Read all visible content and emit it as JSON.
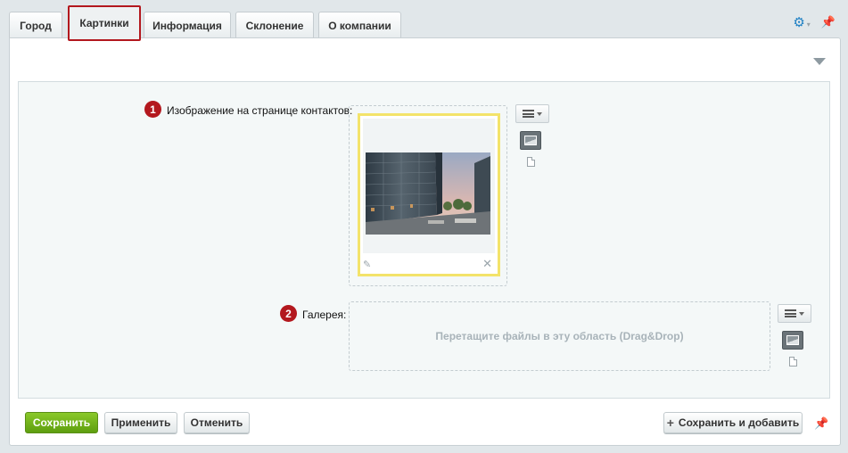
{
  "tabs": [
    {
      "label": "Город",
      "active": false
    },
    {
      "label": "Картинки",
      "active": true
    },
    {
      "label": "Информация",
      "active": false
    },
    {
      "label": "Склонение",
      "active": false
    },
    {
      "label": "О компании",
      "active": false
    }
  ],
  "fields": {
    "contact_image": {
      "number": "1",
      "label": "Изображение на странице контактов:"
    },
    "gallery": {
      "number": "2",
      "label": "Галерея:",
      "dropzone_text": "Перетащите файлы в эту область (Drag&Drop)"
    }
  },
  "footer": {
    "save": "Сохранить",
    "apply": "Применить",
    "cancel": "Отменить",
    "save_and_add": "Сохранить и добавить"
  },
  "colors": {
    "accent_red": "#b3181e",
    "save_green": "#6fb11c",
    "highlight_yellow": "#f3e36a",
    "gear_blue": "#1f80c4"
  },
  "icons": [
    "gear-icon",
    "pin-icon",
    "collapse-arrow-icon",
    "menu-icon",
    "image-icon",
    "file-icon",
    "edit-icon",
    "delete-icon",
    "plus-icon"
  ]
}
